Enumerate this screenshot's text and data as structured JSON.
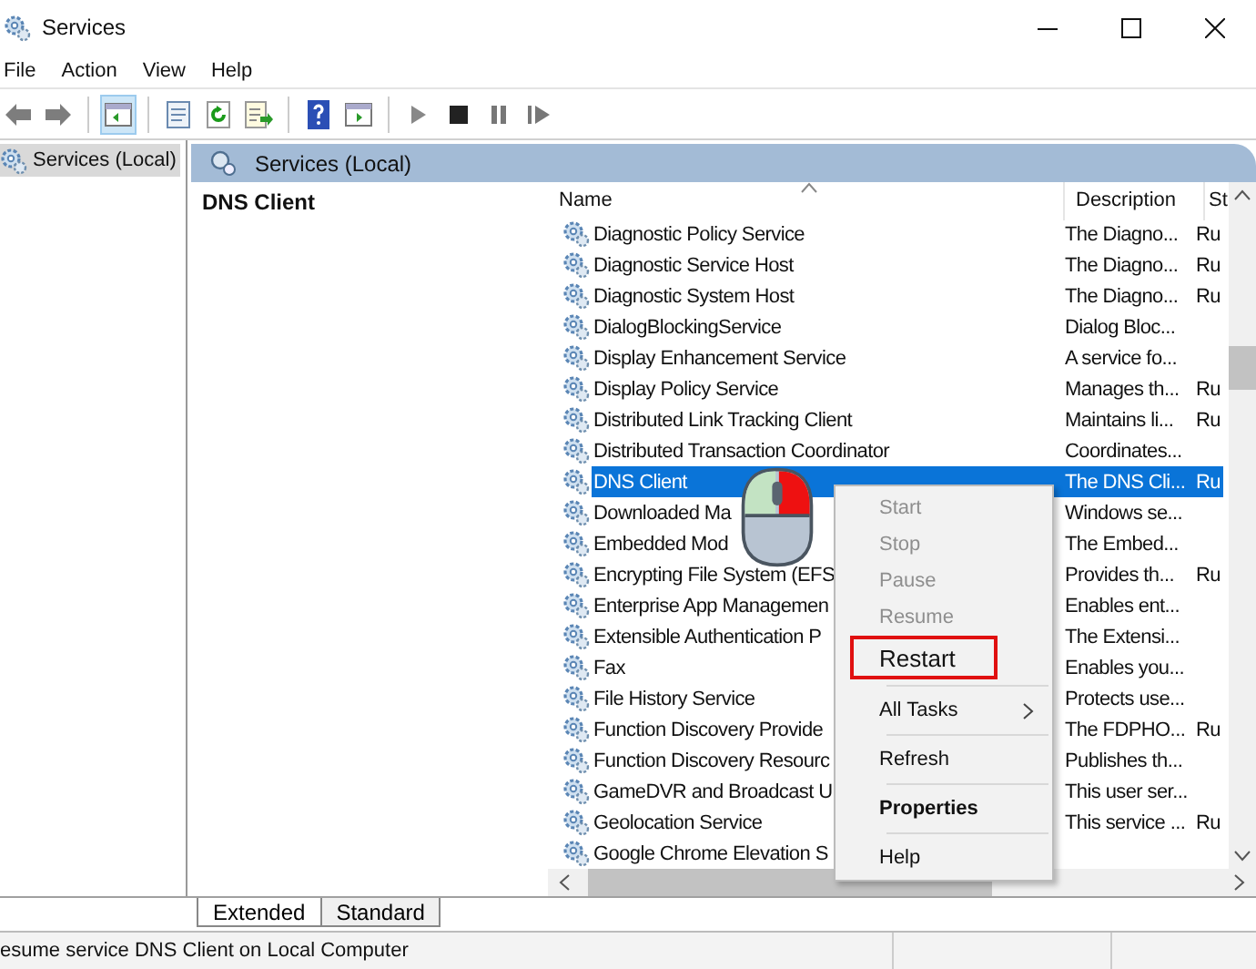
{
  "window": {
    "title": "Services"
  },
  "menu": [
    "File",
    "Action",
    "View",
    "Help"
  ],
  "toolbar": [
    {
      "kind": "back"
    },
    {
      "kind": "forward"
    },
    {
      "kind": "sep"
    },
    {
      "kind": "tree",
      "selected": true
    },
    {
      "kind": "sep"
    },
    {
      "kind": "props",
      "selected": false
    },
    {
      "kind": "refresh",
      "selected": false
    },
    {
      "kind": "export",
      "selected": false
    },
    {
      "kind": "sep"
    },
    {
      "kind": "help",
      "selected": false
    },
    {
      "kind": "pane",
      "selected": false
    },
    {
      "kind": "sep"
    },
    {
      "kind": "play"
    },
    {
      "kind": "stop"
    },
    {
      "kind": "pause"
    },
    {
      "kind": "resume"
    }
  ],
  "tree": {
    "items": [
      {
        "label": "Services (Local)",
        "selected": true
      }
    ]
  },
  "pane": {
    "title": "Services (Local)",
    "detail_title": "DNS Client"
  },
  "table": {
    "columns": [
      "Name",
      "Description",
      "St"
    ],
    "rows": [
      {
        "name": "Diagnostic Policy Service",
        "description": "The Diagno...",
        "status": "Ru",
        "selected": false
      },
      {
        "name": "Diagnostic Service Host",
        "description": "The Diagno...",
        "status": "Ru",
        "selected": false
      },
      {
        "name": "Diagnostic System Host",
        "description": "The Diagno...",
        "status": "Ru",
        "selected": false
      },
      {
        "name": "DialogBlockingService",
        "description": "Dialog Bloc...",
        "selected": false
      },
      {
        "name": "Display Enhancement Service",
        "description": "A service fo...",
        "selected": false
      },
      {
        "name": "Display Policy Service",
        "description": "Manages th...",
        "status": "Ru",
        "selected": false
      },
      {
        "name": "Distributed Link Tracking Client",
        "description": "Maintains li...",
        "status": "Ru",
        "selected": false
      },
      {
        "name": "Distributed Transaction Coordinator",
        "description": "Coordinates...",
        "selected": false
      },
      {
        "name": "DNS Client",
        "description": "The DNS Cli...",
        "status": "Ru",
        "selected": true
      },
      {
        "name": "Downloaded Ma",
        "description": "Windows se...",
        "selected": false
      },
      {
        "name": "Embedded Mod",
        "description": "The Embed...",
        "selected": false
      },
      {
        "name": "Encrypting File System (EFS",
        "description": "Provides th...",
        "status": "Ru",
        "selected": false
      },
      {
        "name": "Enterprise App Managemen",
        "description": "Enables ent...",
        "selected": false
      },
      {
        "name": "Extensible Authentication P",
        "description": "The Extensi...",
        "selected": false
      },
      {
        "name": "Fax",
        "description": "Enables you...",
        "selected": false
      },
      {
        "name": "File History Service",
        "description": "Protects use...",
        "selected": false
      },
      {
        "name": "Function Discovery Provide",
        "description": "The FDPHO...",
        "status": "Ru",
        "selected": false
      },
      {
        "name": "Function Discovery Resourc",
        "description": "Publishes th...",
        "selected": false
      },
      {
        "name": "GameDVR and Broadcast U",
        "description": "This user ser...",
        "selected": false
      },
      {
        "name": "Geolocation Service",
        "description": "This service ...",
        "status": "Ru",
        "selected": false
      },
      {
        "name": "Google Chrome Elevation S",
        "selected": false
      }
    ]
  },
  "context_menu": [
    {
      "label": "Start",
      "kind": "item",
      "disabled": true
    },
    {
      "label": "Stop",
      "kind": "item",
      "disabled": true
    },
    {
      "label": "Pause",
      "kind": "item",
      "disabled": true
    },
    {
      "label": "Resume",
      "kind": "item",
      "disabled": true
    },
    {
      "label": "Restart",
      "kind": "item",
      "disabled": false,
      "outlined": true
    },
    {
      "kind": "separator"
    },
    {
      "label": "All Tasks",
      "kind": "submenu",
      "disabled": false
    },
    {
      "kind": "separator"
    },
    {
      "label": "Refresh",
      "kind": "item",
      "disabled": false
    },
    {
      "kind": "separator"
    },
    {
      "label": "Properties",
      "kind": "item",
      "disabled": false,
      "bold": true
    },
    {
      "kind": "separator"
    },
    {
      "label": "Help",
      "kind": "item",
      "disabled": false
    }
  ],
  "tabs": [
    {
      "label": "Extended",
      "selected": true
    },
    {
      "label": "Standard",
      "selected": false
    }
  ],
  "status_bar": {
    "text": "esume service DNS Client on Local Computer"
  }
}
